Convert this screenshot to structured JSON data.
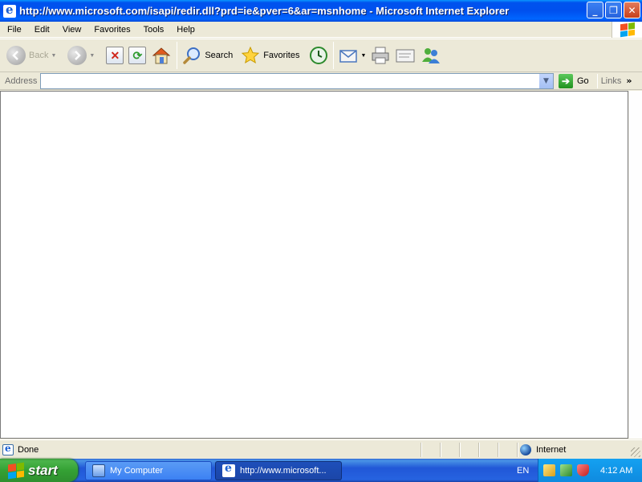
{
  "window": {
    "title": "http://www.microsoft.com/isapi/redir.dll?prd=ie&pver=6&ar=msnhome - Microsoft Internet Explorer",
    "controls": {
      "minimize": "_",
      "maximize": "❐",
      "close": "✕"
    }
  },
  "menu": {
    "items": [
      {
        "label": "File"
      },
      {
        "label": "Edit"
      },
      {
        "label": "View"
      },
      {
        "label": "Favorites"
      },
      {
        "label": "Tools"
      },
      {
        "label": "Help"
      }
    ]
  },
  "toolbar": {
    "back_label": "Back",
    "search_label": "Search",
    "favorites_label": "Favorites",
    "icons": [
      "back-icon",
      "forward-icon",
      "stop-icon",
      "refresh-icon",
      "home-icon",
      "search-icon",
      "favorites-star-icon",
      "history-icon",
      "mail-icon",
      "print-icon",
      "edit-icon",
      "messenger-icon"
    ]
  },
  "address": {
    "label": "Address",
    "value": "",
    "go_label": "Go",
    "links_label": "Links"
  },
  "status": {
    "text": "Done",
    "zone": "Internet"
  },
  "taskbar": {
    "start_label": "start",
    "tasks": [
      {
        "label": "My Computer"
      },
      {
        "label": "http://www.microsoft..."
      }
    ],
    "language": "EN",
    "clock": "4:12 AM"
  },
  "colors": {
    "titlebar_blue": "#0053ee",
    "taskbar_blue": "#2157d7",
    "start_green": "#34a134",
    "chrome_beige": "#ece9d8"
  }
}
